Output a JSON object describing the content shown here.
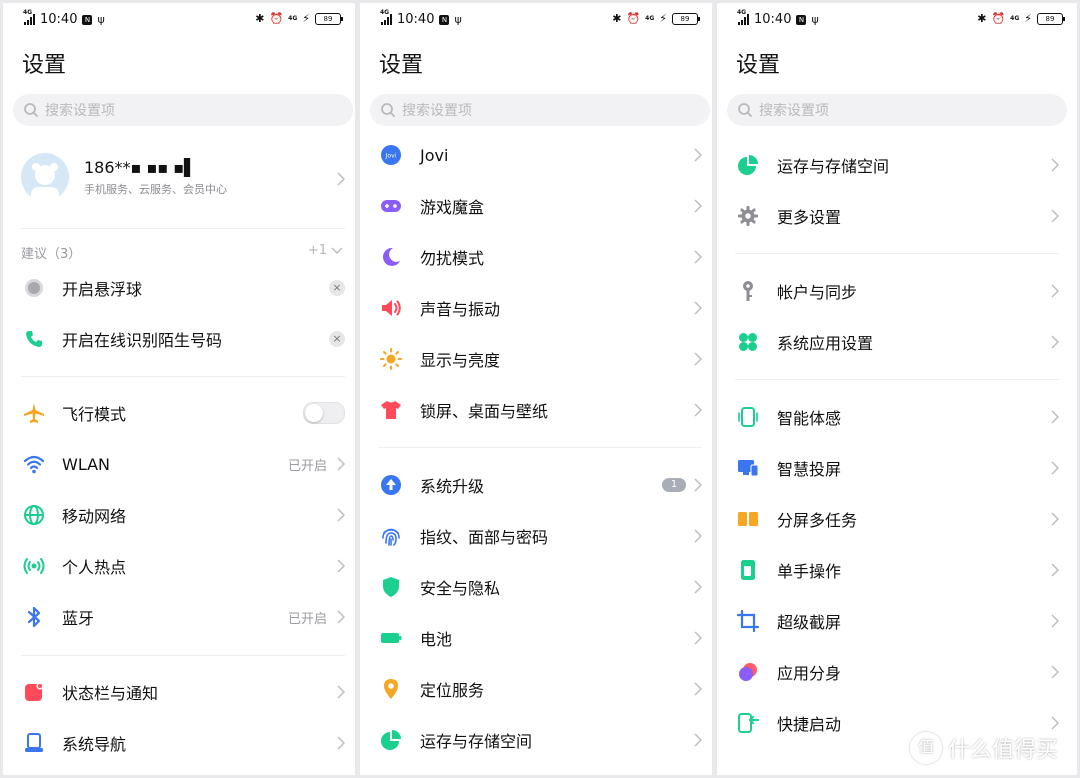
{
  "status_bar": {
    "network": "4G",
    "time": "10:40",
    "square_icon_text": "N",
    "right_network": "4G",
    "battery": "89"
  },
  "panels": [
    {
      "title": "设置",
      "search_placeholder": "搜索设置项",
      "account": {
        "name": "186**▪ ▪▪ ▪▌",
        "subtitle": "手机服务、云服务、会员中心"
      },
      "suggestions": {
        "label": "建议（3）",
        "more": "+1",
        "items": [
          {
            "label": "开启悬浮球",
            "icon": "floating-ball-icon"
          },
          {
            "label": "开启在线识别陌生号码",
            "icon": "phone-icon"
          }
        ]
      },
      "items": [
        {
          "label": "飞行模式",
          "icon": "airplane-icon",
          "value": ""
        },
        {
          "label": "WLAN",
          "icon": "wifi-icon",
          "value": "已开启"
        },
        {
          "label": "移动网络",
          "icon": "globe-icon",
          "value": ""
        },
        {
          "label": "个人热点",
          "icon": "hotspot-icon",
          "value": ""
        },
        {
          "label": "蓝牙",
          "icon": "bluetooth-icon",
          "value": "已开启"
        },
        {
          "label": "状态栏与通知",
          "icon": "notification-icon",
          "value": ""
        },
        {
          "label": "系统导航",
          "icon": "navigation-icon",
          "value": ""
        }
      ]
    },
    {
      "title": "设置",
      "search_placeholder": "搜索设置项",
      "items": [
        {
          "label": "Jovi",
          "icon": "jovi-icon"
        },
        {
          "label": "游戏魔盒",
          "icon": "gamepad-icon"
        },
        {
          "label": "勿扰模式",
          "icon": "moon-icon"
        },
        {
          "label": "声音与振动",
          "icon": "speaker-icon"
        },
        {
          "label": "显示与亮度",
          "icon": "sun-icon"
        },
        {
          "label": "锁屏、桌面与壁纸",
          "icon": "shirt-icon"
        },
        {
          "label": "系统升级",
          "icon": "upgrade-icon",
          "badge": "1"
        },
        {
          "label": "指纹、面部与密码",
          "icon": "fingerprint-icon"
        },
        {
          "label": "安全与隐私",
          "icon": "shield-icon"
        },
        {
          "label": "电池",
          "icon": "battery-icon"
        },
        {
          "label": "定位服务",
          "icon": "location-icon"
        },
        {
          "label": "运存与存储空间",
          "icon": "storage-pie-icon"
        }
      ]
    },
    {
      "title": "设置",
      "search_placeholder": "搜索设置项",
      "items": [
        {
          "label": "运存与存储空间",
          "icon": "storage-pie-icon"
        },
        {
          "label": "更多设置",
          "icon": "gear-icon"
        },
        {
          "label": "帐户与同步",
          "icon": "key-icon"
        },
        {
          "label": "系统应用设置",
          "icon": "clover-icon"
        },
        {
          "label": "智能体感",
          "icon": "motion-phone-icon"
        },
        {
          "label": "智慧投屏",
          "icon": "screen-cast-icon"
        },
        {
          "label": "分屏多任务",
          "icon": "split-screen-icon"
        },
        {
          "label": "单手操作",
          "icon": "one-hand-icon"
        },
        {
          "label": "超级截屏",
          "icon": "crop-icon"
        },
        {
          "label": "应用分身",
          "icon": "app-clone-icon"
        },
        {
          "label": "快捷启动",
          "icon": "quick-launch-icon"
        }
      ]
    }
  ],
  "watermark": {
    "logo": "值",
    "text": "什么值得买"
  },
  "colors": {
    "blue": "#3a76f0",
    "green": "#1bcf8f",
    "purple": "#8b5cf6",
    "red": "#ff4a5a",
    "orange": "#f5a623"
  }
}
